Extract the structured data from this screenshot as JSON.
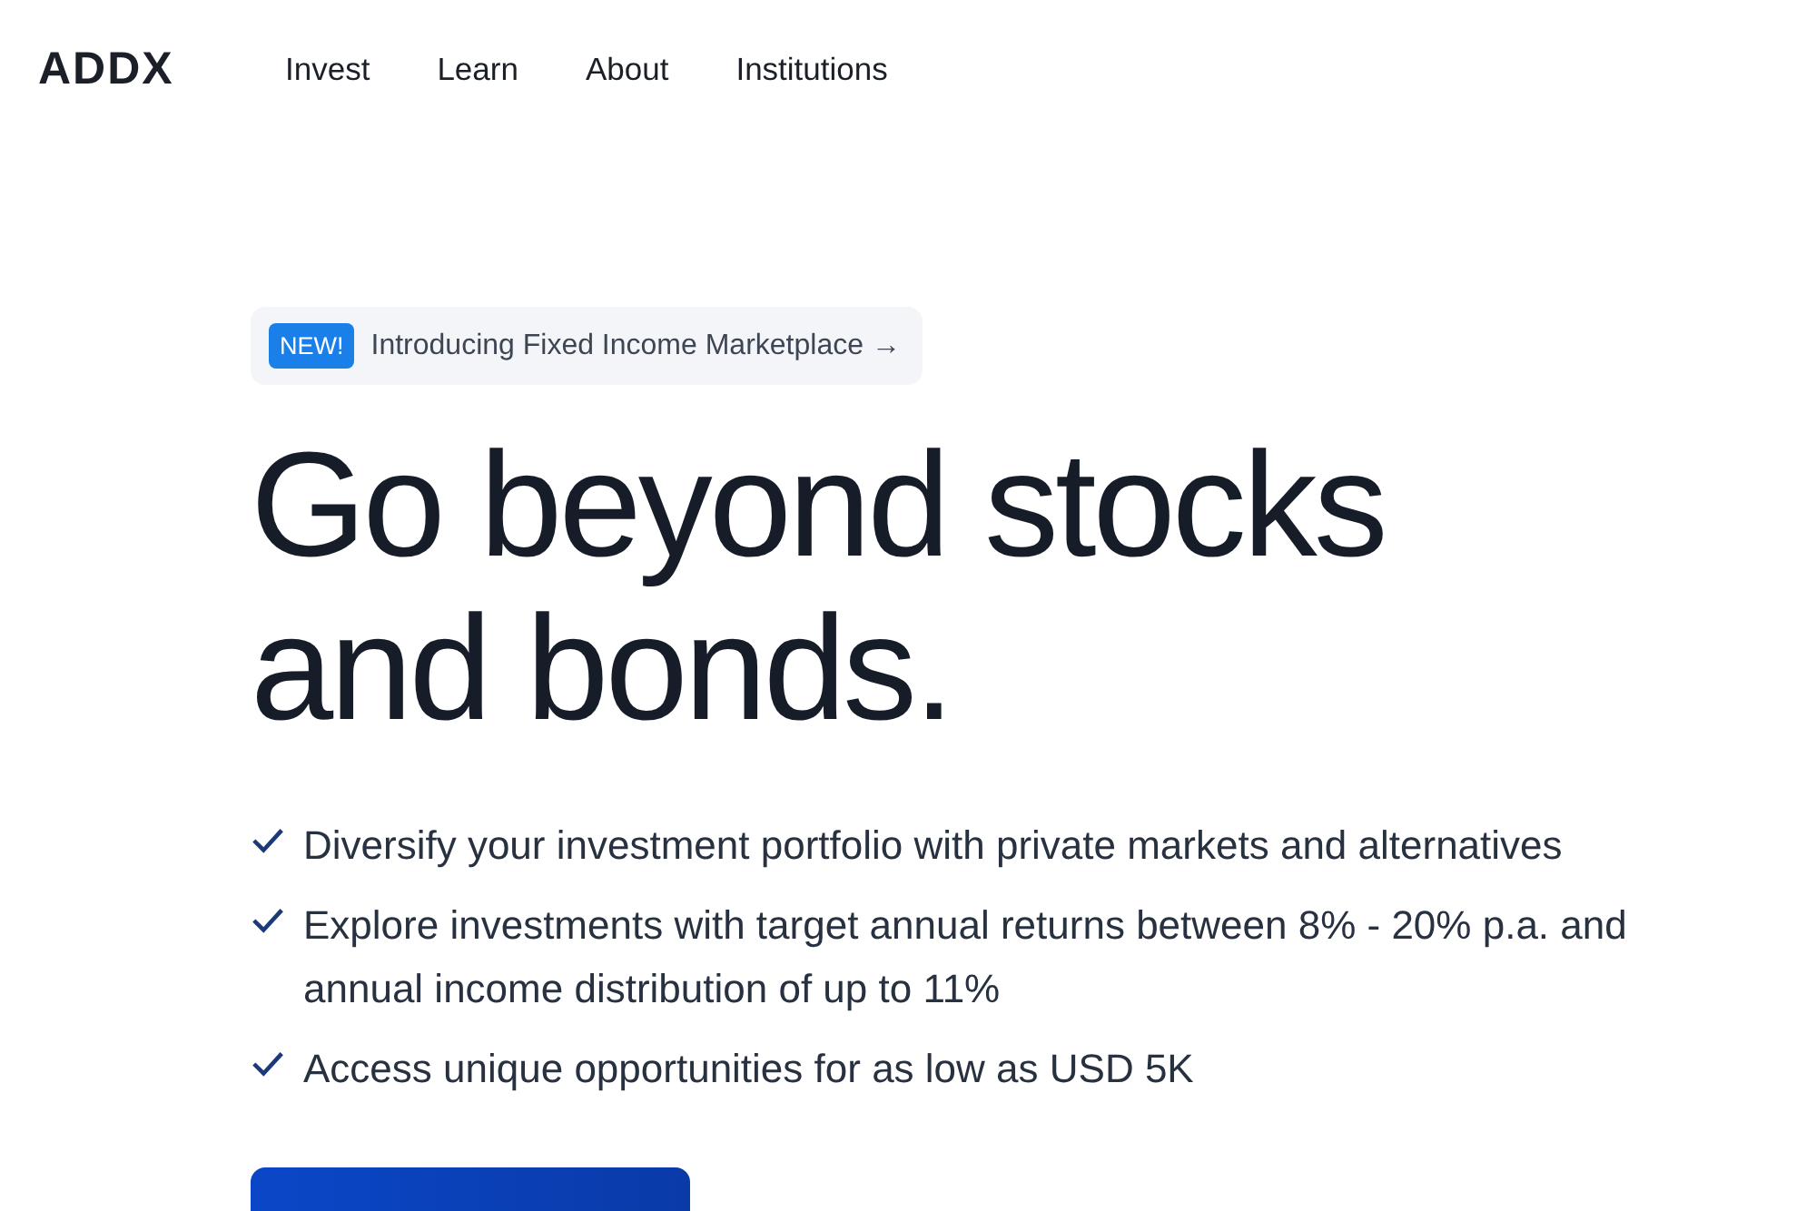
{
  "header": {
    "logo": "ADDX",
    "nav": [
      {
        "label": "Invest"
      },
      {
        "label": "Learn"
      },
      {
        "label": "About"
      },
      {
        "label": "Institutions"
      }
    ]
  },
  "hero": {
    "announcement": {
      "badge": "NEW!",
      "text": "Introducing Fixed Income Marketplace →"
    },
    "headline": [
      "Go beyond stocks",
      "and bonds."
    ],
    "points": [
      "Diversify your investment portfolio with private markets and alternatives",
      "Explore investments with target annual returns between 8% - 20% p.a. and annual income distribution of up to 11%",
      "Access unique opportunities for as low as USD 5K"
    ],
    "cta": {
      "kind": "primary"
    }
  }
}
